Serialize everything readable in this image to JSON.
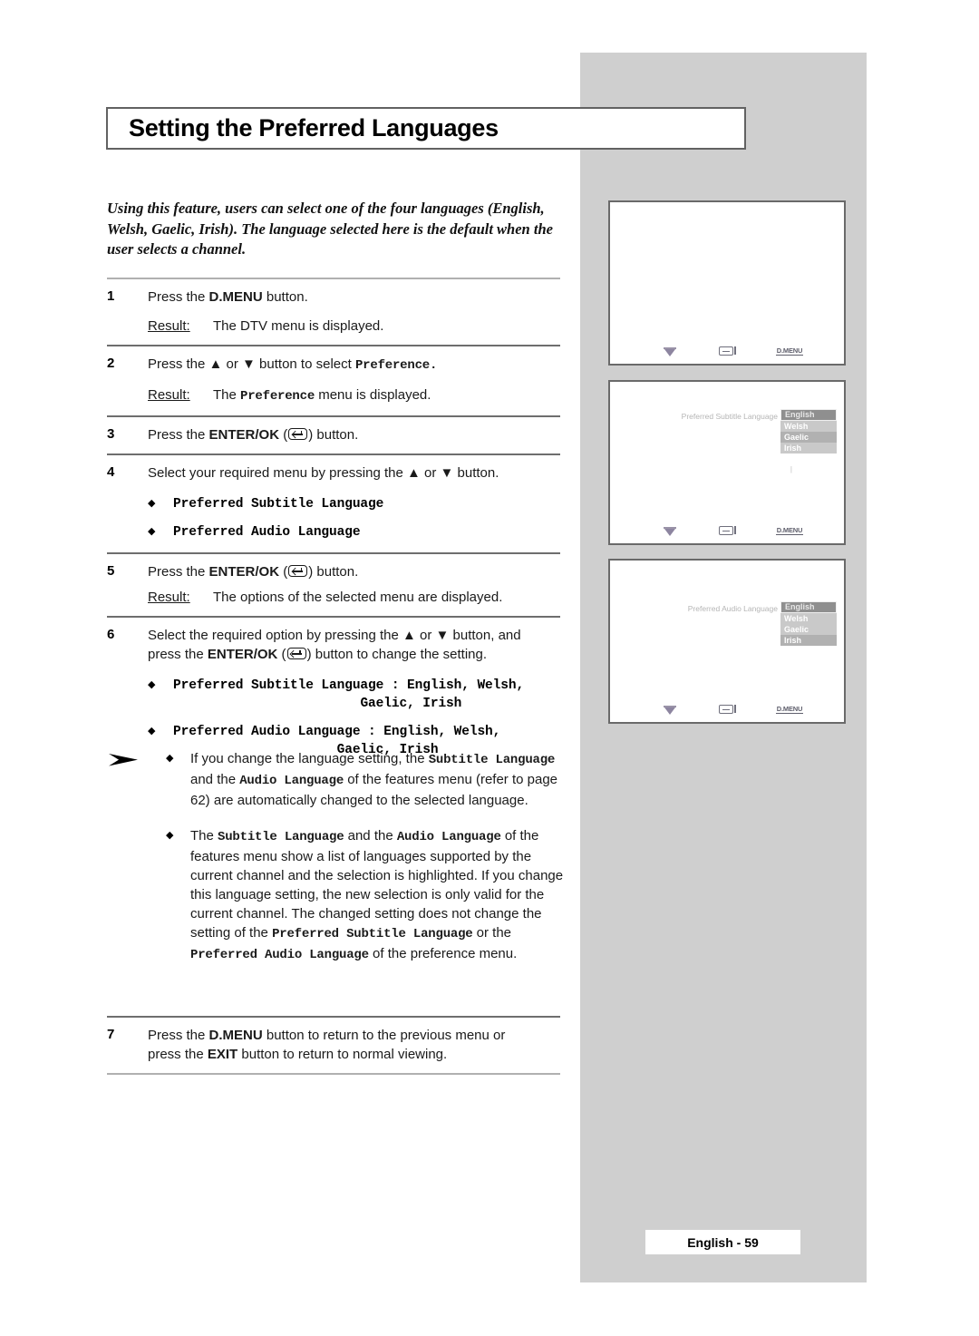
{
  "page": {
    "title": "Setting the Preferred Languages",
    "intro": "Using this feature, users can select one of the four languages (English, Welsh, Gaelic, Irish). The language selected here is the default when the user selects a channel.",
    "footer": "English - 59"
  },
  "steps": [
    {
      "number": "1",
      "instruction_prefix": "Press the ",
      "instruction_bold": "D.MENU",
      "instruction_suffix": " button.",
      "result_label": "Result:",
      "result_text": "The DTV menu is displayed."
    },
    {
      "number": "2",
      "instruction_prefix": "Press the ▲ or ▼ button to select ",
      "instruction_mono": "Preference.",
      "result_label": "Result:",
      "result_pre": "The ",
      "result_mono": "Preference",
      "result_post": " menu is displayed."
    },
    {
      "number": "3",
      "instruction_prefix": "Press the ",
      "instruction_bold": "ENTER/OK",
      "instruction_suffix": " button."
    },
    {
      "number": "4",
      "instruction": "Select your required menu by pressing the ▲ or ▼ button.",
      "bullets": [
        "Preferred Subtitle Language",
        "Preferred Audio Language"
      ]
    },
    {
      "number": "5",
      "instruction_prefix": "Press the ",
      "instruction_bold": "ENTER/OK",
      "instruction_suffix": " button.",
      "result_label": "Result:",
      "result_text": "The options of the selected menu are displayed."
    },
    {
      "number": "6",
      "instruction_line1": "Select the required option by pressing the ▲ or ▼ button, and",
      "instruction_line2_pre": "press the ",
      "instruction_line2_bold": "ENTER/OK",
      "instruction_line2_post": " button to change the setting.",
      "bullets": [
        "Preferred Subtitle Language : English, Welsh,\n                        Gaelic, Irish",
        "Preferred Audio Language : English, Welsh,\n                     Gaelic, Irish"
      ]
    },
    {
      "number": "7",
      "line1_pre": "Press the ",
      "line1_bold": "D.MENU",
      "line1_post": " button to return to the previous menu or",
      "line2_pre": "press the ",
      "line2_bold": "EXIT",
      "line2_post": " button to return to normal viewing."
    }
  ],
  "notes": {
    "marker": "arrow-note-marker",
    "items": [
      {
        "p1": "If you change the language setting, the ",
        "m1": "Subtitle Language",
        "p2": " and the ",
        "m2": "Audio Language",
        "p3": " of the features menu (refer to page 62) are automatically changed to the selected language."
      },
      {
        "p1": "The ",
        "m1": "Subtitle Language",
        "p2": " and the ",
        "m2": "Audio Language",
        "p3": " of the features menu show a list of languages supported by the current channel and the selection is highlighted. If you change this language setting, the new selection is only valid for the current channel. The changed setting does not change the setting of the ",
        "m3": "Preferred Subtitle Language",
        "p4": " or the ",
        "m4": "Preferred Audio Language",
        "p5": " of the preference menu."
      }
    ]
  },
  "screens": [
    {
      "id": "screen-1",
      "osd_visible": false,
      "icons": [
        "down-arrow-icon",
        "enter-return-icon",
        "D.MENU"
      ]
    },
    {
      "id": "screen-2",
      "osd_visible": true,
      "osd_label": "Preferred Subtitle Language",
      "options": [
        "English",
        "Welsh",
        "Gaelic",
        "Irish"
      ],
      "selected_option": "English",
      "icons": [
        "down-arrow-icon",
        "enter-return-icon",
        "D.MENU"
      ]
    },
    {
      "id": "screen-3",
      "osd_visible": true,
      "osd_label": "Preferred Audio Language",
      "options": [
        "English",
        "Welsh",
        "Gaelic",
        "Irish"
      ],
      "selected_option": "English",
      "icons": [
        "down-arrow-icon",
        "enter-return-icon",
        "D.MENU"
      ]
    }
  ],
  "icon_labels": {
    "dmenu": "D.MENU"
  },
  "colors": {
    "panel_grey": "#cfcfcf",
    "rule_grey": "#9a9a9a",
    "osd_bg": "#c9c9c9",
    "osd_selected": "#8f8f8f"
  }
}
